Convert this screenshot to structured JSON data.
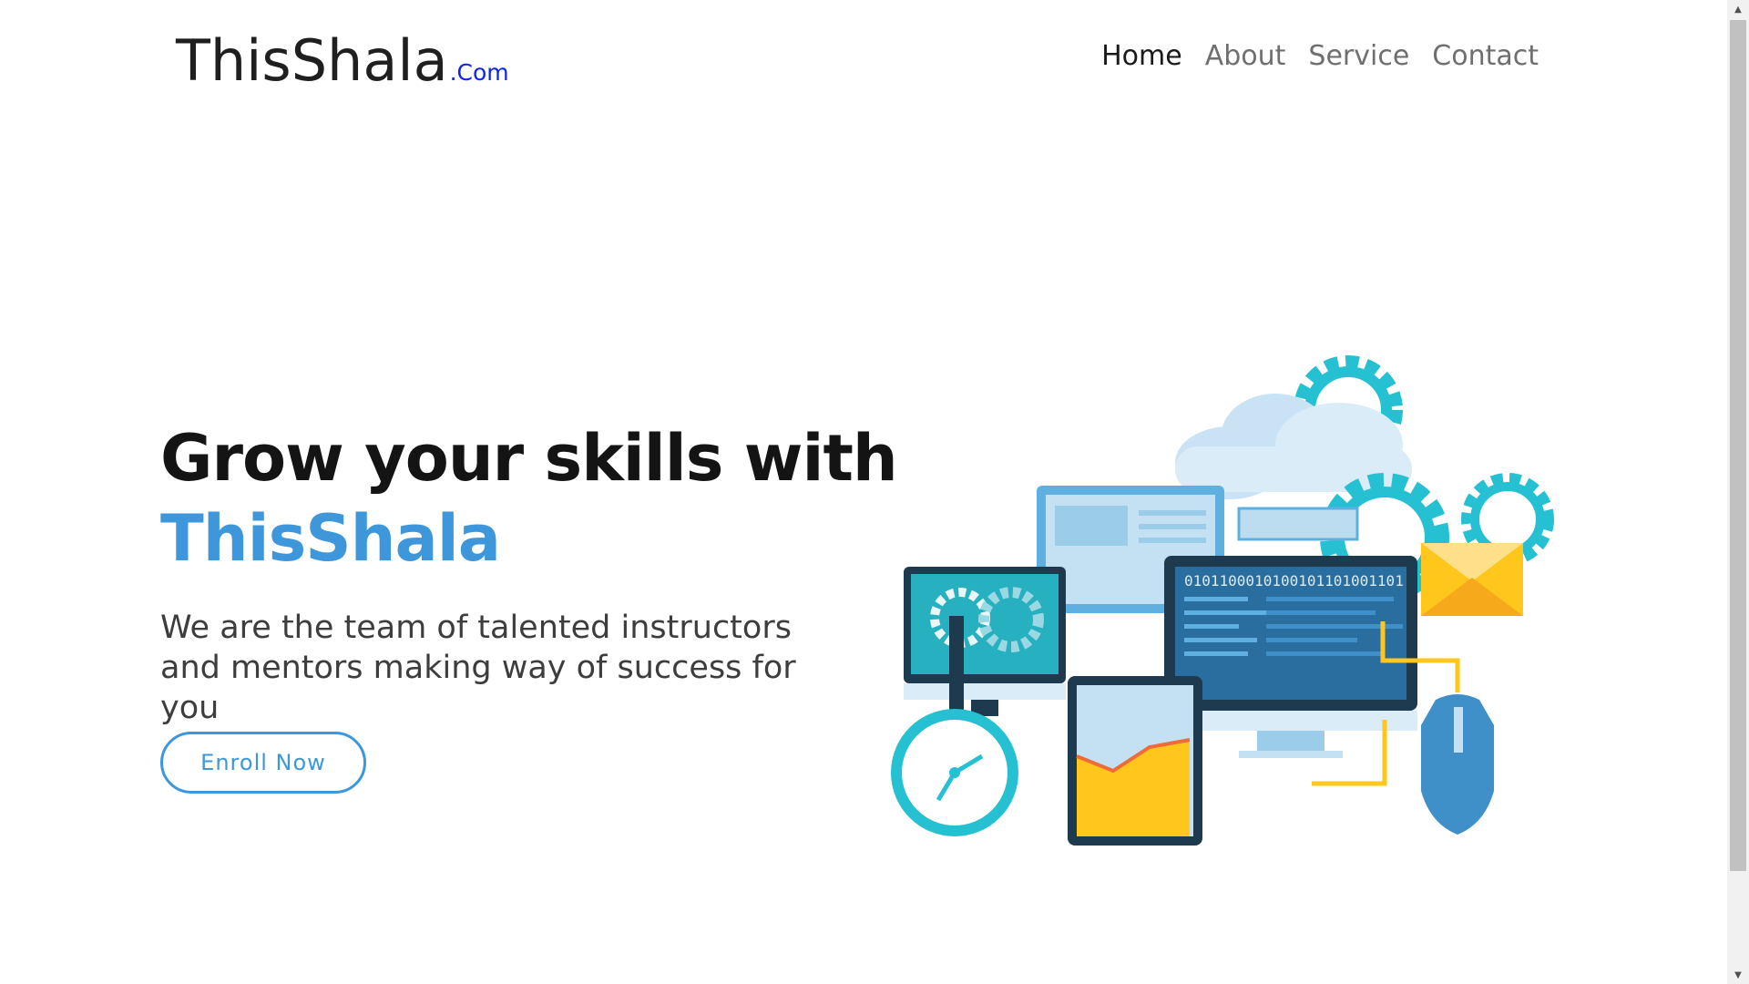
{
  "header": {
    "brand_main": "ThisShala",
    "brand_tld": ".Com",
    "nav": [
      {
        "label": "Home",
        "active": true
      },
      {
        "label": "About"
      },
      {
        "label": "Service"
      },
      {
        "label": "Contact"
      }
    ]
  },
  "hero": {
    "headline_line1": "Grow your skills with",
    "headline_accent": "ThisShala",
    "subtext": "We are the team of talented instructors and mentors making way of success for you",
    "cta_label": "Enroll Now"
  },
  "illustration": {
    "binary_text": "0101100010100101101001101"
  },
  "colors": {
    "accent": "#3d97da",
    "brand_tld": "#1024e8",
    "teal": "#26c0d3",
    "yellow": "#ffc61b",
    "dark": "#1e3a4f"
  }
}
